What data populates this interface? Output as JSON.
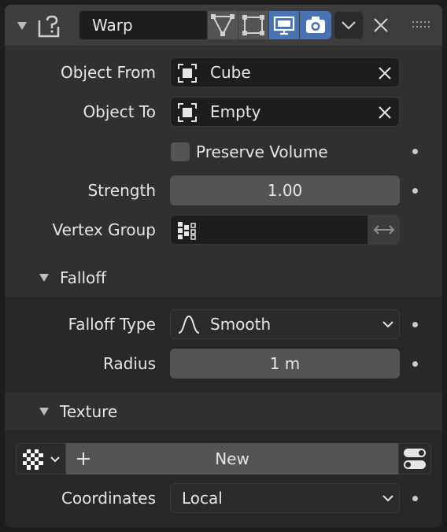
{
  "header": {
    "modifier_name": "Warp",
    "toggles": [
      "edit-mode",
      "cage",
      "viewport",
      "render"
    ]
  },
  "fields": {
    "object_from": {
      "label": "Object From",
      "value": "Cube"
    },
    "object_to": {
      "label": "Object To",
      "value": "Empty"
    },
    "preserve_volume": {
      "label": "Preserve Volume",
      "checked": false
    },
    "strength": {
      "label": "Strength",
      "value": "1.00"
    },
    "vertex_group": {
      "label": "Vertex Group",
      "value": ""
    }
  },
  "falloff": {
    "title": "Falloff",
    "falloff_type": {
      "label": "Falloff Type",
      "value": "Smooth"
    },
    "radius": {
      "label": "Radius",
      "value": "1 m"
    }
  },
  "texture": {
    "title": "Texture",
    "new_label": "New",
    "coordinates": {
      "label": "Coordinates",
      "value": "Local"
    }
  },
  "colors": {
    "accent": "#4772b3",
    "panel": "#303030",
    "field": "#1d1d1d",
    "slider": "#545454"
  }
}
